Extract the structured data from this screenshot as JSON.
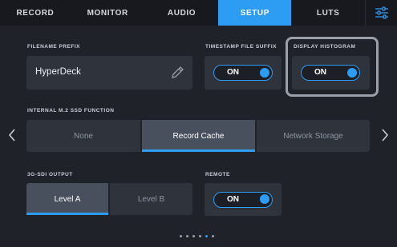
{
  "nav": {
    "tabs": [
      {
        "label": "RECORD"
      },
      {
        "label": "MONITOR"
      },
      {
        "label": "AUDIO"
      },
      {
        "label": "SETUP"
      },
      {
        "label": "LUTS"
      }
    ],
    "active_tab": "SETUP",
    "settings_icon": "sliders-icon"
  },
  "filename_prefix": {
    "label": "FILENAME PREFIX",
    "value": "HyperDeck",
    "edit_icon": "pencil-icon"
  },
  "timestamp_suffix": {
    "label": "TIMESTAMP FILE SUFFIX",
    "state": "ON"
  },
  "display_histogram": {
    "label": "DISPLAY HISTOGRAM",
    "state": "ON"
  },
  "ssd_function": {
    "label": "INTERNAL M.2 SSD FUNCTION",
    "options": [
      "None",
      "Record Cache",
      "Network Storage"
    ],
    "selected": "Record Cache"
  },
  "sdi_output": {
    "label": "3G-SDI OUTPUT",
    "options": [
      "Level A",
      "Level B"
    ],
    "selected": "Level A"
  },
  "remote": {
    "label": "REMOTE",
    "state": "ON"
  },
  "pagination": {
    "pages": 6,
    "current_page": 5
  },
  "colors": {
    "accent": "#2d9cf3",
    "background": "#1f2228",
    "panel": "#2e333c",
    "selected_segment": "#48505d"
  }
}
